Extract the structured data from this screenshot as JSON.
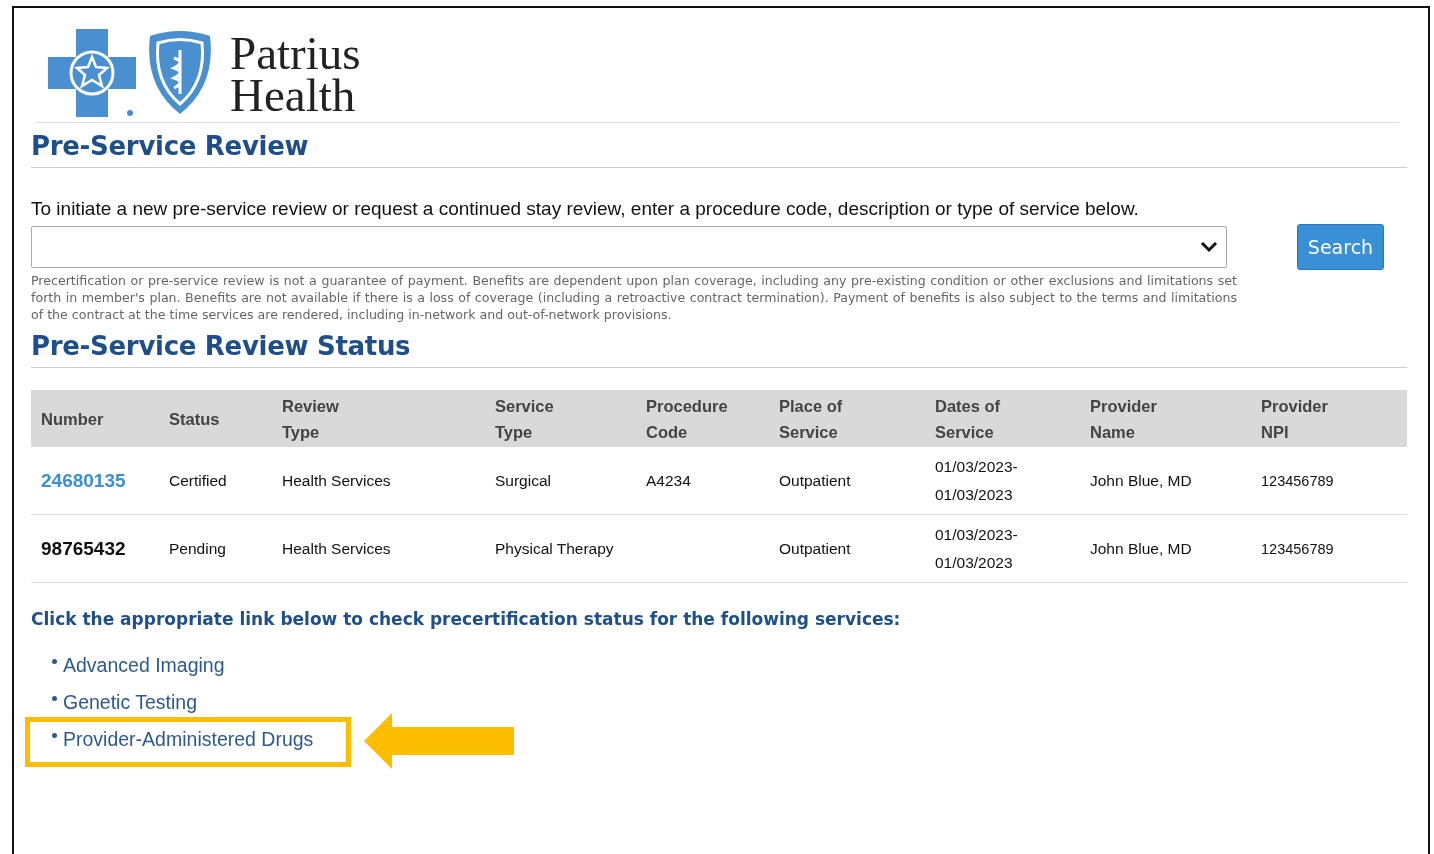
{
  "logo": {
    "text": "Patrius Health"
  },
  "review": {
    "title": "Pre-Service Review",
    "instruction": "To initiate a new pre-service review or request a continued stay review, enter a procedure code, description or type of service below.",
    "search_button": "Search",
    "disclaimer": "Precertification or pre-service review is not a guarantee of payment. Benefits are dependent upon plan coverage, including any pre-existing condition or other exclusions and limitations set forth in member's plan. Benefits are not available if there is a loss of coverage (including a retroactive contract termination). Payment of benefits is also subject to the terms and limitations of the contract at the time services are rendered, including in-network and out-of-network provisions."
  },
  "status": {
    "title": "Pre-Service Review Status",
    "columns": [
      "Number",
      "Status",
      "Review Type",
      "Service Type",
      "Procedure Code",
      "Place of Service",
      "Dates of Service",
      "Provider Name",
      "Provider NPI"
    ],
    "rows": [
      {
        "kind": "link",
        "cells": [
          "24680135",
          "Certified",
          "Health Services",
          "Surgical",
          "A4234",
          "Outpatient",
          "01/03/2023-01/03/2023",
          "John Blue, MD",
          "123456789"
        ]
      },
      {
        "kind": "plain",
        "cells": [
          "98765432",
          "Pending",
          "Health Services",
          "Physical Therapy",
          "",
          "Outpatient",
          "01/03/2023-01/03/2023",
          "John Blue, MD",
          "123456789"
        ]
      }
    ]
  },
  "services": {
    "heading": "Click the appropriate link below to check precertification status for the following services:",
    "links": [
      {
        "label": "Advanced Imaging",
        "highlighted": false
      },
      {
        "label": "Genetic Testing",
        "highlighted": false
      },
      {
        "label": "Provider-Administered Drugs",
        "highlighted": true
      }
    ]
  }
}
